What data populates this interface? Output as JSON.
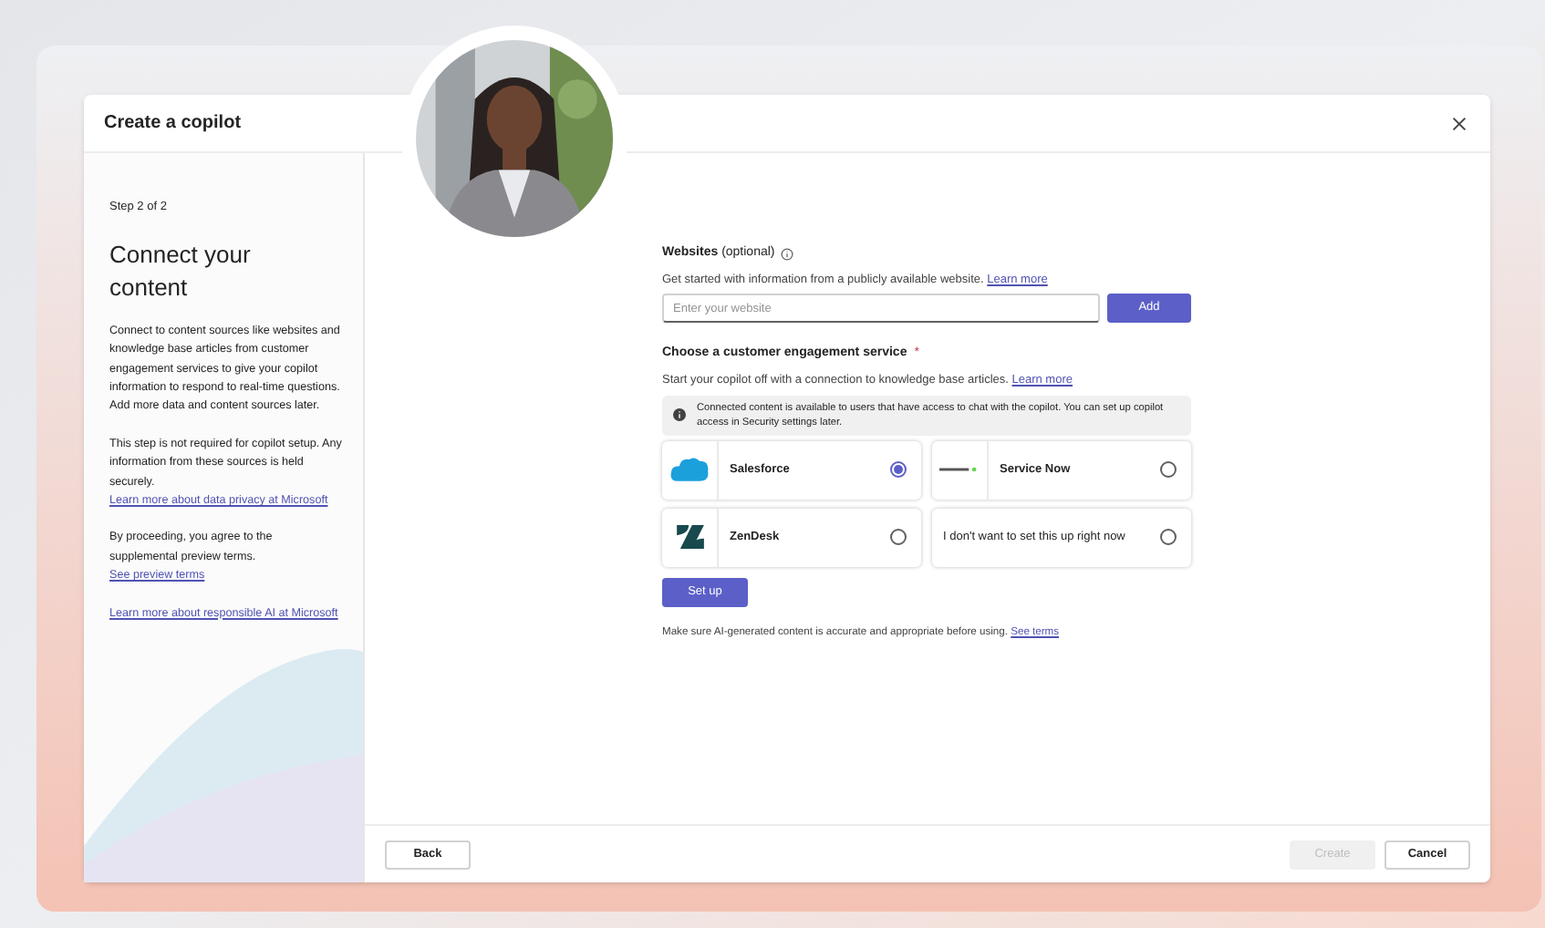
{
  "dialog": {
    "title": "Create a copilot"
  },
  "sidebar": {
    "step": "Step 2 of 2",
    "heading": "Connect your content",
    "paragraphs": [
      {
        "text": "Connect to content sources like websites and knowledge base articles from customer engagement services to give your copilot information to respond to real-time questions. Add more data and content sources later."
      },
      {
        "text": "This step is not required for copilot setup. Any information from these sources is held securely.",
        "link": "Learn more about data privacy at Microsoft"
      },
      {
        "text": "By proceeding, you agree to the supplemental preview terms.",
        "link": "See preview terms"
      },
      {
        "link": "Learn more about responsible AI at Microsoft"
      }
    ]
  },
  "websites": {
    "label": "Websites",
    "optional": "(optional)",
    "description": "Get started with information from a publicly available website.",
    "link": "Learn more",
    "placeholder": "Enter your website",
    "button": "Add"
  },
  "service": {
    "label": "Choose a customer engagement service",
    "required": "*",
    "description": "Start your copilot off with a connection to knowledge base articles.",
    "link": "Learn more",
    "info": "Connected content is available to users that have access to chat with the copilot. You can set up copilot access in Security settings later.",
    "options": [
      {
        "kind": "salesforce",
        "label": "Salesforce",
        "selected": true
      },
      {
        "kind": "servicenow",
        "label": "Service Now",
        "selected": false
      },
      {
        "kind": "zendesk",
        "label": "ZenDesk",
        "selected": false
      },
      {
        "kind": "none",
        "label": "I don't want to set this up right now",
        "selected": false
      }
    ],
    "button": "Set up"
  },
  "disclaimer": {
    "text": "Make sure AI-generated content is accurate and appropriate before using.",
    "link": "See terms"
  },
  "footer": {
    "back": "Back",
    "create": {
      "label": "Create",
      "disabled": true
    },
    "cancel": "Cancel"
  }
}
